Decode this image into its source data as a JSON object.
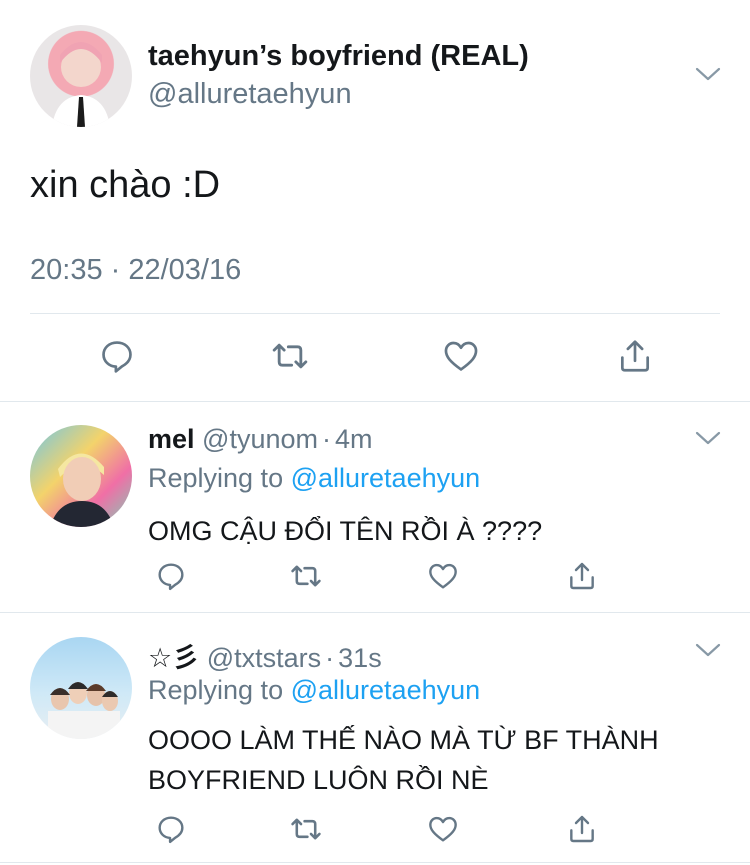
{
  "main_tweet": {
    "display_name": "taehyun’s boyfriend (REAL)",
    "handle": "@alluretaehyun",
    "text": "xin chào :D",
    "timestamp": "20:35 · 22/03/16"
  },
  "replies": [
    {
      "name": "mel",
      "handle": "@tyunom",
      "age": "4m",
      "replying_label": "Replying to",
      "replying_handle": "@alluretaehyun",
      "text_line1": "OMG CẬU ĐỔI TÊN RỒI À ????",
      "text_line2": ""
    },
    {
      "name": "☆彡",
      "handle": "@txtstars",
      "age": "31s",
      "replying_label": "Replying to",
      "replying_handle": "@alluretaehyun",
      "text_line1": "OOOO LÀM THẾ NÀO MÀ TỪ BF THÀNH",
      "text_line2": "BOYFRIEND LUÔN RỒI NÈ"
    }
  ],
  "separator": "·",
  "icons": [
    "chevron-down-icon",
    "reply-icon",
    "retweet-icon",
    "like-icon",
    "share-icon"
  ],
  "colors": {
    "text": "#14171a",
    "muted": "#657786",
    "link": "#1da1f2",
    "divider": "#e1e8ed"
  }
}
